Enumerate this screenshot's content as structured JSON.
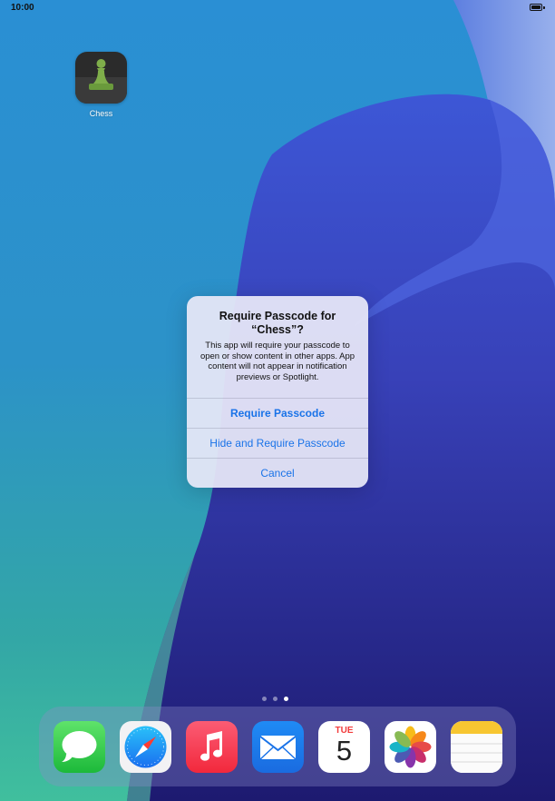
{
  "status_bar": {
    "time": "10:00"
  },
  "home": {
    "apps": [
      {
        "label": "Chess"
      }
    ]
  },
  "alert": {
    "title": "Require Passcode for “Chess”?",
    "message": "This app will require your passcode to open or show content in other apps. App content will not appear in notification previews or Spotlight.",
    "buttons": {
      "require": "Require Passcode",
      "hide_require": "Hide and Require Passcode",
      "cancel": "Cancel"
    }
  },
  "page_dots": {
    "count": 3,
    "active_index": 2
  },
  "dock": {
    "apps": [
      {
        "name": "Messages",
        "icon": "messages-icon"
      },
      {
        "name": "Safari",
        "icon": "safari-icon"
      },
      {
        "name": "Music",
        "icon": "music-icon"
      },
      {
        "name": "Mail",
        "icon": "mail-icon"
      },
      {
        "name": "Calendar",
        "icon": "calendar-icon",
        "weekday": "TUE",
        "day": "5"
      },
      {
        "name": "Photos",
        "icon": "photos-icon"
      },
      {
        "name": "Notes",
        "icon": "notes-icon"
      }
    ]
  },
  "colors": {
    "accent": "#1a73e8",
    "alert_background": "#e8e8f8"
  }
}
